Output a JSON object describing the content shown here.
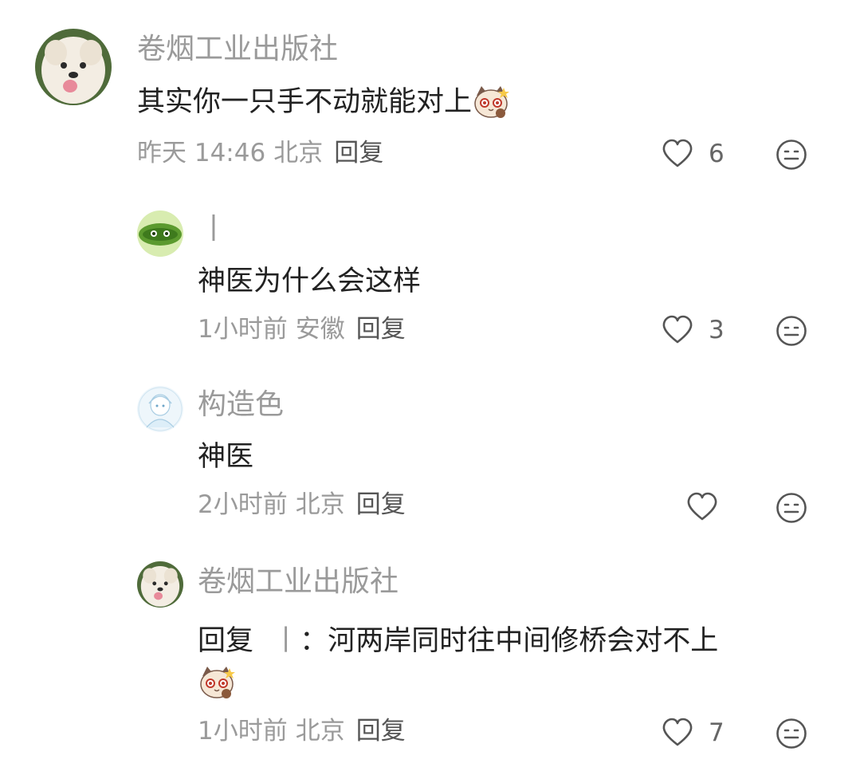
{
  "comments": [
    {
      "username": "卷烟工业出版社",
      "text": "其实你一只手不动就能对上",
      "time": "昨天 14:46",
      "location": "北京",
      "reply_label": "回复",
      "likes": "6"
    },
    {
      "username": "丨",
      "text": "神医为什么会这样",
      "time": "1小时前",
      "location": "安徽",
      "reply_label": "回复",
      "likes": "3"
    },
    {
      "username": "构造色",
      "text": "神医",
      "time": "2小时前",
      "location": "北京",
      "reply_label": "回复",
      "likes": ""
    },
    {
      "username": "卷烟工业出版社",
      "reply_prefix": "回复",
      "reply_target": "丨",
      "text": "河两岸同时往中间修桥会对不上",
      "time": "1小时前",
      "location": "北京",
      "reply_label": "回复",
      "likes": "7"
    }
  ],
  "icons": {
    "like": "heart-outline-icon",
    "dislike": "meh-face-icon",
    "sticker": "cat-sticker-icon"
  },
  "colors": {
    "username": "#9a9a9a",
    "text": "#222222",
    "meta": "#9a9a9a",
    "icon": "#555555"
  }
}
